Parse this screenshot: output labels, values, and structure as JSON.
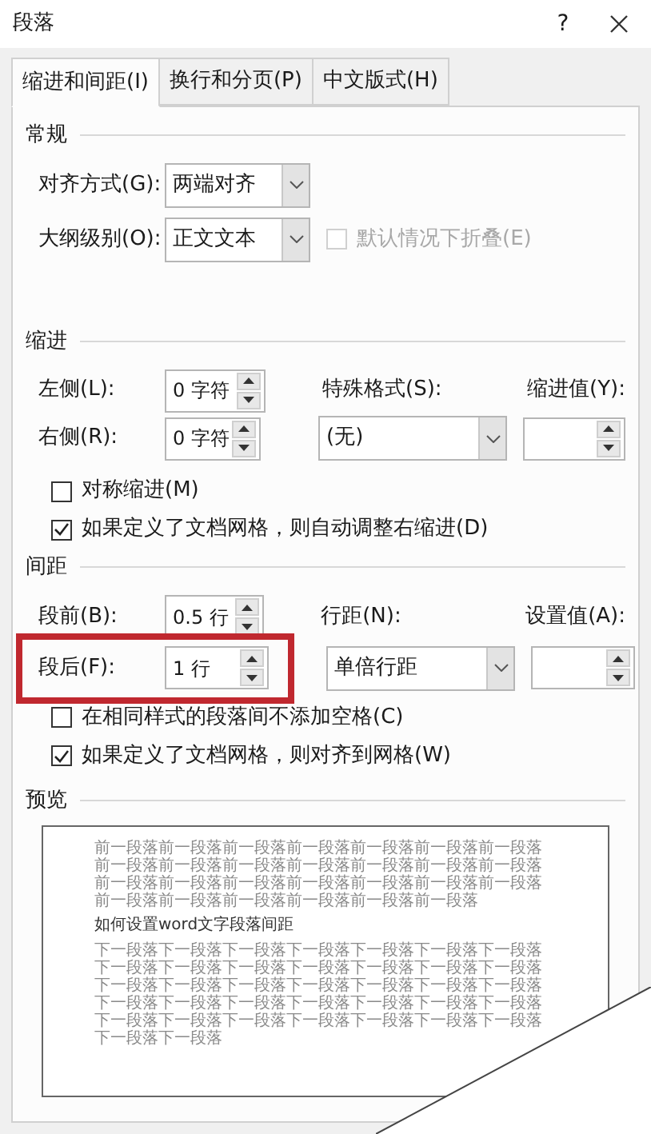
{
  "window": {
    "title": "段落",
    "help": "?"
  },
  "tabs": [
    {
      "label": "缩进和间距(I)",
      "selected": true
    },
    {
      "label": "换行和分页(P)",
      "selected": false
    },
    {
      "label": "中文版式(H)",
      "selected": false
    }
  ],
  "general": {
    "title": "常规",
    "alignment": {
      "label": "对齐方式(G):",
      "value": "两端对齐"
    },
    "outline_level": {
      "label": "大纲级别(O):",
      "value": "正文文本"
    },
    "collapse": {
      "label": "默认情况下折叠(E)",
      "checked": false,
      "disabled": true
    }
  },
  "indent": {
    "title": "缩进",
    "left": {
      "label": "左侧(L):",
      "value": "0 字符"
    },
    "right": {
      "label": "右侧(R):",
      "value": "0 字符"
    },
    "special": {
      "label": "特殊格式(S):",
      "value": "(无)"
    },
    "by": {
      "label": "缩进值(Y):"
    },
    "checkboxes": [
      {
        "label": "对称缩进(M)",
        "checked": false
      },
      {
        "label": "如果定义了文档网格，则自动调整右缩进(D)",
        "checked": true
      }
    ]
  },
  "spacing": {
    "title": "间距",
    "before": {
      "label": "段前(B):",
      "value": "0.5 行"
    },
    "after": {
      "label": "段后(F):",
      "value": "1 行",
      "highlighted": true
    },
    "line_spacing": {
      "label": "行距(N):",
      "value": "单倍行距"
    },
    "at": {
      "label": "设置值(A):"
    },
    "checkboxes": [
      {
        "label": "在相同样式的段落间不添加空格(C)",
        "checked": false
      },
      {
        "label": "如果定义了文档网格，则对齐到网格(W)",
        "checked": true
      }
    ]
  },
  "preview": {
    "title": "预览",
    "previous": "前一段落前一段落前一段落前一段落前一段落前一段落前一段落前一段落前一段落前一段落前一段落前一段落前一段落前一段落前一段落前一段落前一段落前一段落前一段落前一段落前一段落前一段落前一段落前一段落前一段落前一段落前一段落",
    "sample": "如何设置word文字段落间距",
    "next": "下一段落下一段落下一段落下一段落下一段落下一段落下一段落下一段落下一段落下一段落下一段落下一段落下一段落下一段落下一段落下一段落下一段落下一段落下一段落下一段落下一段落下一段落下一段落下一段落下一段落下一段落下一段落下一段落下一段落下一段落下一段落下一段落下一段落下一段落下一段落下一段落下一段落"
  }
}
